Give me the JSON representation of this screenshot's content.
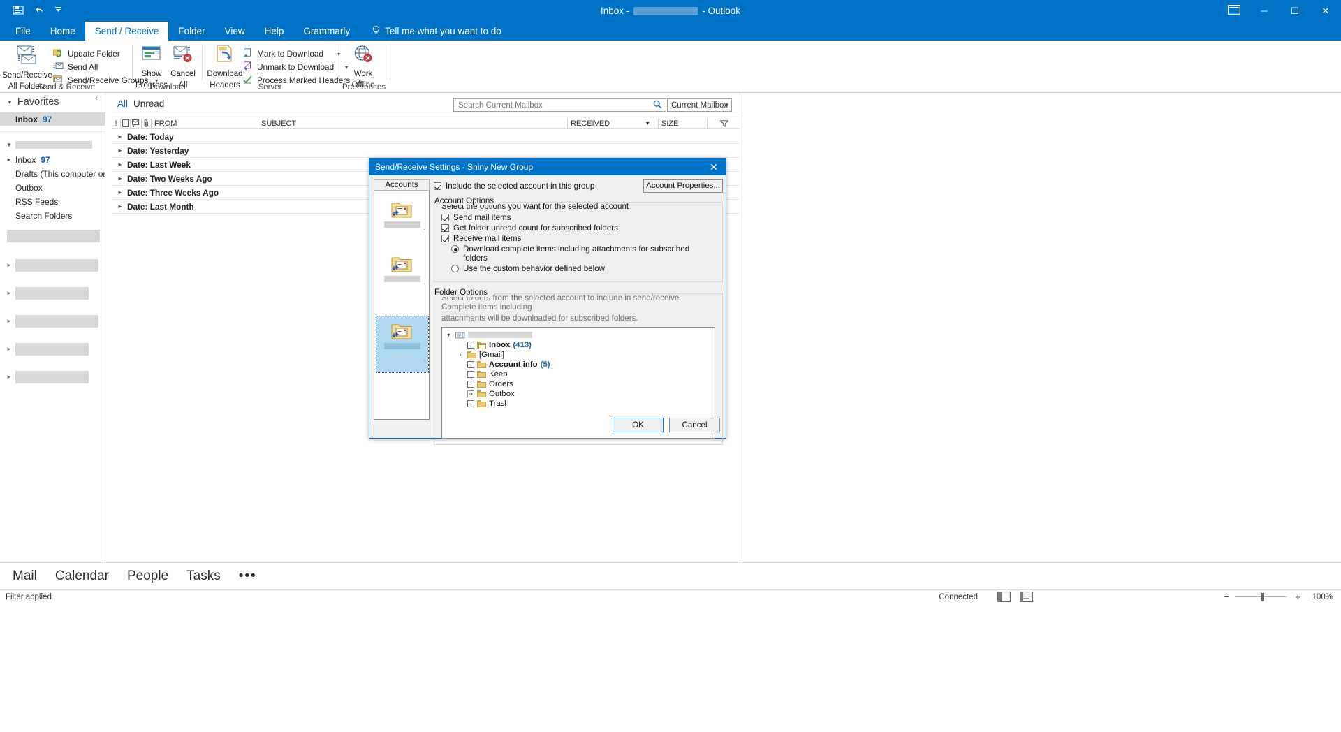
{
  "titlebar": {
    "quick_access": [
      "save-icon",
      "undo-icon",
      "customize-qat-icon"
    ],
    "title_prefix": "Inbox -",
    "title_suffix": "- Outlook",
    "ribbon_display_icon": "ribbon-display-options-icon",
    "minimize": "─",
    "maximize": "☐",
    "close": "✕"
  },
  "tabs": [
    {
      "label": "File",
      "active": false
    },
    {
      "label": "Home",
      "active": false
    },
    {
      "label": "Send / Receive",
      "active": true
    },
    {
      "label": "Folder",
      "active": false
    },
    {
      "label": "View",
      "active": false
    },
    {
      "label": "Help",
      "active": false
    },
    {
      "label": "Grammarly",
      "active": false
    }
  ],
  "tell_me": {
    "label": "Tell me what you want to do",
    "icon": "lightbulb-icon"
  },
  "ribbon": {
    "groups": [
      {
        "label": "Send & Receive",
        "big_buttons": [
          {
            "label_line1": "Send/Receive",
            "label_line2": "All Folders",
            "icon": "send-receive-all-folders-icon"
          }
        ],
        "small_items": [
          {
            "label": "Update Folder",
            "icon": "update-folder-icon",
            "caret": false
          },
          {
            "label": "Send All",
            "icon": "send-all-icon",
            "caret": false
          },
          {
            "label": "Send/Receive Groups",
            "icon": "send-receive-groups-icon",
            "caret": true
          }
        ]
      },
      {
        "label": "Download",
        "big_buttons": [
          {
            "label_line1": "Show",
            "label_line2": "Progress",
            "icon": "show-progress-icon"
          },
          {
            "label_line1": "Cancel",
            "label_line2": "All",
            "icon": "cancel-all-icon"
          }
        ],
        "small_items": []
      },
      {
        "label": "Server",
        "big_buttons": [
          {
            "label_line1": "Download",
            "label_line2": "Headers",
            "icon": "download-headers-icon"
          }
        ],
        "small_items": [
          {
            "label": "Mark to Download",
            "icon": "mark-to-download-icon",
            "caret": true
          },
          {
            "label": "Unmark to Download",
            "icon": "unmark-to-download-icon",
            "caret": true
          },
          {
            "label": "Process Marked Headers",
            "icon": "process-marked-headers-icon",
            "caret": true
          }
        ]
      },
      {
        "label": "Preferences",
        "big_buttons": [
          {
            "label_line1": "Work",
            "label_line2": "Offline",
            "icon": "work-offline-icon"
          }
        ],
        "small_items": []
      }
    ]
  },
  "navpane": {
    "collapse_icon": "collapse-pane-icon",
    "favorites_label": "Favorites",
    "favorites_items": [
      {
        "label": "Inbox",
        "count": "97",
        "selected": true
      }
    ],
    "account_items": [
      {
        "label": "Inbox",
        "count": "97",
        "expandable": true
      },
      {
        "label": "Drafts (This computer only)",
        "count": "",
        "expandable": false
      },
      {
        "label": "Outbox",
        "count": "",
        "expandable": false
      },
      {
        "label": "RSS Feeds",
        "count": "",
        "expandable": false
      },
      {
        "label": "Search Folders",
        "count": "",
        "expandable": false
      }
    ]
  },
  "list": {
    "filters": [
      {
        "label": "All",
        "active": true
      },
      {
        "label": "Unread",
        "active": false
      }
    ],
    "search": {
      "placeholder": "Search Current Mailbox",
      "value": "",
      "icon": "search-icon"
    },
    "scope": {
      "value": "Current Mailbox",
      "caret": "▾"
    },
    "columns": [
      {
        "label": "!",
        "icon": "importance-icon"
      },
      {
        "label": "",
        "icon": "reminder-icon"
      },
      {
        "label": "",
        "icon": "flag-status-icon"
      },
      {
        "label": "",
        "icon": "attachment-icon"
      },
      {
        "label": "FROM",
        "icon": ""
      },
      {
        "label": "SUBJECT",
        "icon": ""
      },
      {
        "label": "RECEIVED",
        "icon": "sort-descending-icon"
      },
      {
        "label": "SIZE",
        "icon": ""
      },
      {
        "label": "",
        "icon": "filter-icon"
      }
    ],
    "groups": [
      {
        "label": "Date: Today"
      },
      {
        "label": "Date: Yesterday"
      },
      {
        "label": "Date: Last Week"
      },
      {
        "label": "Date: Two Weeks Ago"
      },
      {
        "label": "Date: Three Weeks Ago"
      },
      {
        "label": "Date: Last Month"
      }
    ]
  },
  "modulebar": {
    "items": [
      "Mail",
      "Calendar",
      "People",
      "Tasks"
    ],
    "overflow": "•••"
  },
  "statusbar": {
    "left": "Filter applied",
    "connected": "Connected",
    "normal_view_icon": "normal-view-icon",
    "reading_view_icon": "reading-view-icon",
    "zoom_out": "−",
    "zoom_in": "+",
    "zoom_value": "100%"
  },
  "dialog": {
    "title": "Send/Receive Settings - Shiny New Group",
    "close": "✕",
    "accounts_header": "Accounts",
    "accounts": [
      {
        "name": "",
        "selected": false,
        "icon": "account-folder-icon"
      },
      {
        "name": "",
        "selected": false,
        "icon": "account-folder-icon"
      },
      {
        "name": "",
        "selected": true,
        "icon": "account-folder-icon"
      }
    ],
    "include_account": {
      "label": "Include the selected account in this group",
      "checked": true
    },
    "account_properties_button": "Account Properties...",
    "account_options": {
      "legend": "Account Options",
      "hint": "Select the options you want for the selected account",
      "checkboxes": [
        {
          "label": "Send mail items",
          "checked": true
        },
        {
          "label": "Get folder unread count for subscribed folders",
          "checked": true
        },
        {
          "label": "Receive mail items",
          "checked": true
        }
      ],
      "radios": [
        {
          "label": "Download complete items including attachments for subscribed folders",
          "selected": true
        },
        {
          "label": "Use the custom behavior defined below",
          "selected": false
        }
      ]
    },
    "folder_options": {
      "legend": "Folder Options",
      "hint_line1": "Select folders from the selected account to include in send/receive. Complete items including",
      "hint_line2": "attachments will be downloaded for subscribed folders.",
      "tree": [
        {
          "indent": 0,
          "expander": "˅",
          "checkbox": false,
          "show_checkbox": false,
          "icon": "account-root-icon",
          "label": "",
          "redacted": true,
          "count": "",
          "bold": false
        },
        {
          "indent": 1,
          "expander": "",
          "checkbox": false,
          "show_checkbox": true,
          "icon": "mail-folder-icon",
          "label": "Inbox",
          "redacted": false,
          "count": "(413)",
          "bold": true
        },
        {
          "indent": 1,
          "expander": "›",
          "checkbox": false,
          "show_checkbox": false,
          "icon": "folder-icon",
          "label": "[Gmail]",
          "redacted": false,
          "count": "",
          "bold": false
        },
        {
          "indent": 1,
          "expander": "",
          "checkbox": false,
          "show_checkbox": true,
          "icon": "folder-icon",
          "label": "Account info",
          "redacted": false,
          "count": "(5)",
          "bold": true
        },
        {
          "indent": 1,
          "expander": "",
          "checkbox": false,
          "show_checkbox": true,
          "icon": "folder-icon",
          "label": "Keep",
          "redacted": false,
          "count": "",
          "bold": false
        },
        {
          "indent": 1,
          "expander": "",
          "checkbox": false,
          "show_checkbox": true,
          "icon": "folder-icon",
          "label": "Orders",
          "redacted": false,
          "count": "",
          "bold": false
        },
        {
          "indent": 1,
          "expander": "",
          "checkbox": false,
          "show_checkbox": false,
          "icon": "outbox-icon",
          "label": "Outbox",
          "redacted": false,
          "count": "",
          "bold": false
        },
        {
          "indent": 1,
          "expander": "",
          "checkbox": false,
          "show_checkbox": true,
          "icon": "folder-icon",
          "label": "Trash",
          "redacted": false,
          "count": "",
          "bold": false
        }
      ]
    },
    "ok_button": "OK",
    "cancel_button": "Cancel"
  },
  "colors": {
    "accent": "#0072c6",
    "link": "#1666b0",
    "selection": "#b0d8f0"
  }
}
